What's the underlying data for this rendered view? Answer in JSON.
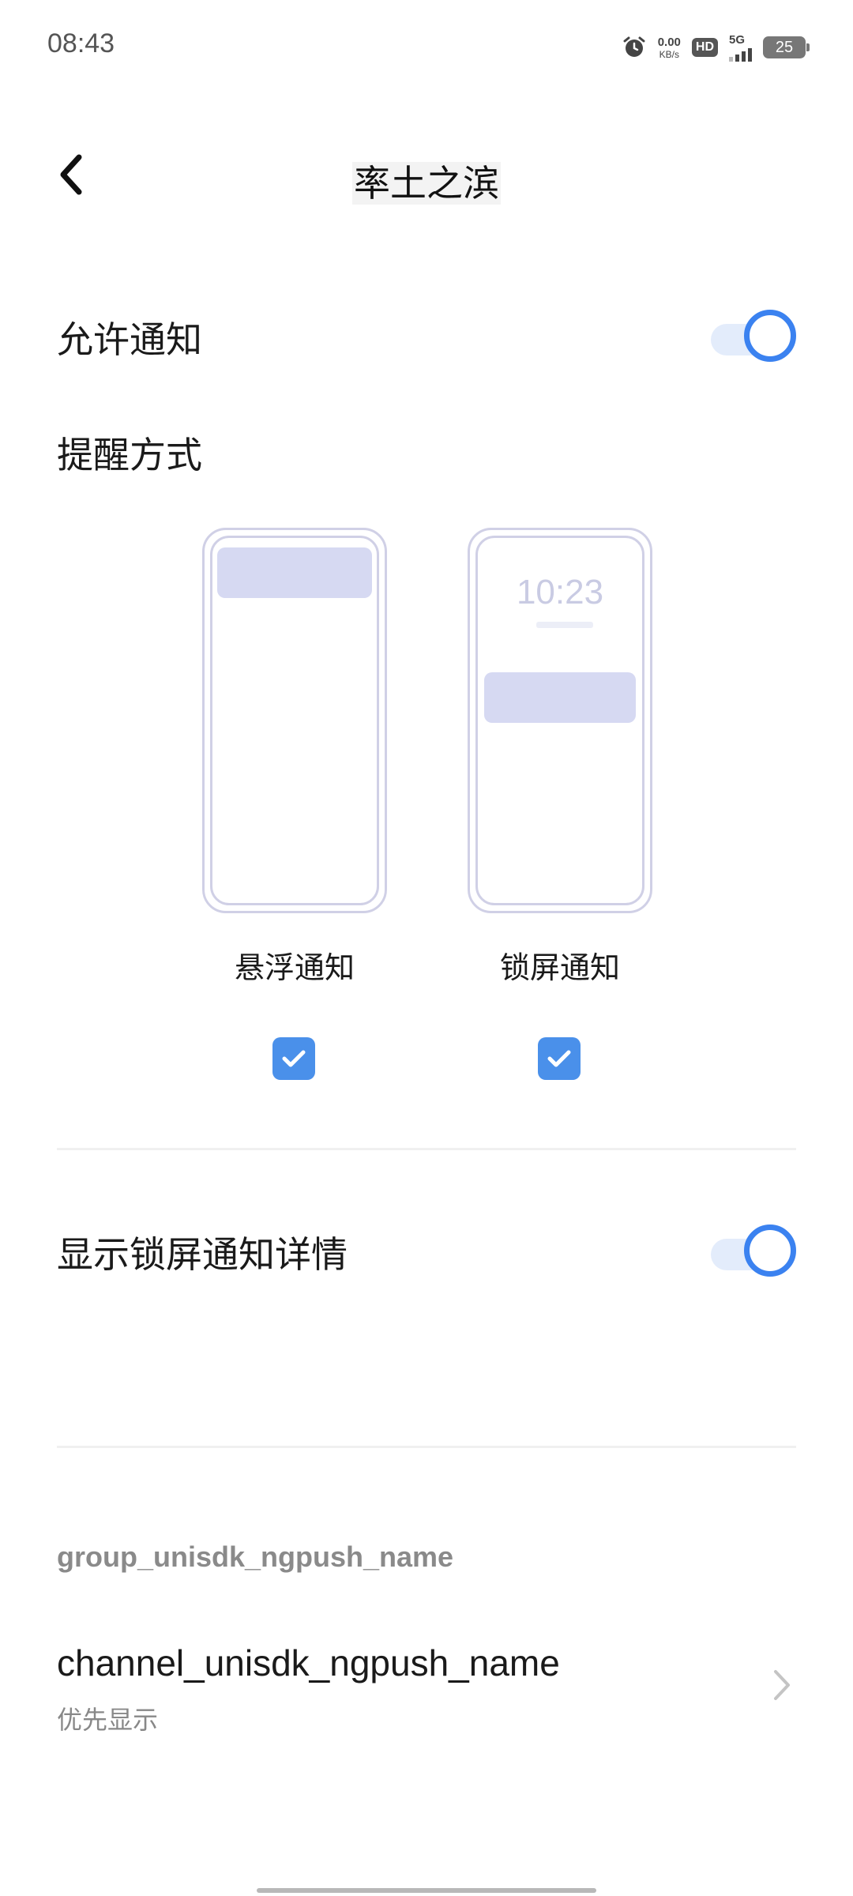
{
  "status_bar": {
    "time": "08:43",
    "net_speed_value": "0.00",
    "net_speed_unit": "KB/s",
    "hd_label": "HD",
    "network_label": "5G",
    "battery": "25",
    "icons": [
      "alarm-icon",
      "hd-icon",
      "signal-icon",
      "battery-icon"
    ]
  },
  "header": {
    "title": "率土之滨",
    "back_icon": "chevron-left-icon"
  },
  "allow_notifications": {
    "label": "允许通知",
    "enabled": true
  },
  "reminder_section": {
    "title": "提醒方式",
    "options": [
      {
        "label": "悬浮通知",
        "checked": true
      },
      {
        "label": "锁屏通知",
        "checked": true,
        "preview_time": "10:23"
      }
    ]
  },
  "lockscreen_details": {
    "label": "显示锁屏通知详情",
    "enabled": true
  },
  "group": {
    "title": "group_unisdk_ngpush_name",
    "channel": {
      "title": "channel_unisdk_ngpush_name",
      "subtitle": "优先显示"
    }
  },
  "colors": {
    "accent": "#3b82f0",
    "checkbox": "#4a90ea",
    "preview_bar": "#d6d9f2"
  }
}
